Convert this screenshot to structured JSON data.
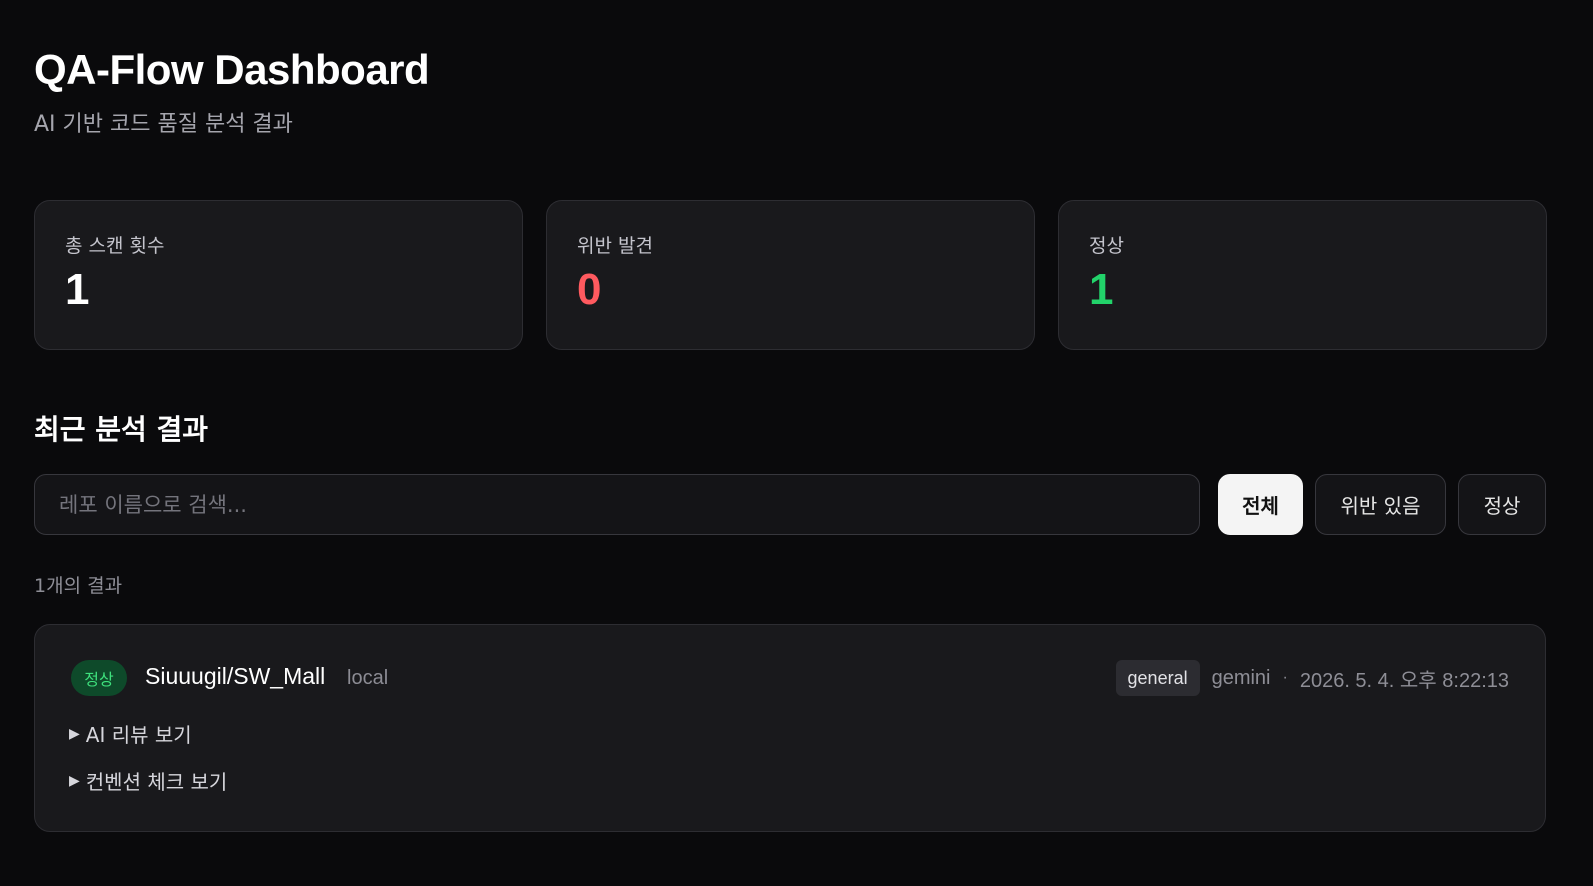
{
  "header": {
    "title": "QA-Flow Dashboard",
    "subtitle": "AI 기반 코드 품질 분석 결과"
  },
  "stats": {
    "total": {
      "label": "총 스캔 횟수",
      "value": "1",
      "color": "#ffffff"
    },
    "violations": {
      "label": "위반 발견",
      "value": "0",
      "color": "#ff5a5f"
    },
    "ok": {
      "label": "정상",
      "value": "1",
      "color": "#22d36a"
    }
  },
  "section": {
    "title": "최근 분석 결과"
  },
  "search": {
    "placeholder": "레포 이름으로 검색...",
    "value": ""
  },
  "filters": {
    "all": "전체",
    "violations": "위반 있음",
    "ok": "정상",
    "active": "all"
  },
  "result_count": "1개의 결과",
  "results": [
    {
      "status": "정상",
      "repo": "Siuuugil/SW_Mall",
      "source": "local",
      "tag": "general",
      "model": "gemini",
      "separator": "·",
      "timestamp": "2026. 5. 4. 오후 8:22:13",
      "ai_review_toggle": "AI 리뷰 보기",
      "convention_toggle": "컨벤션 체크 보기"
    }
  ],
  "icons": {
    "disclosure": "triangle-right-icon"
  }
}
